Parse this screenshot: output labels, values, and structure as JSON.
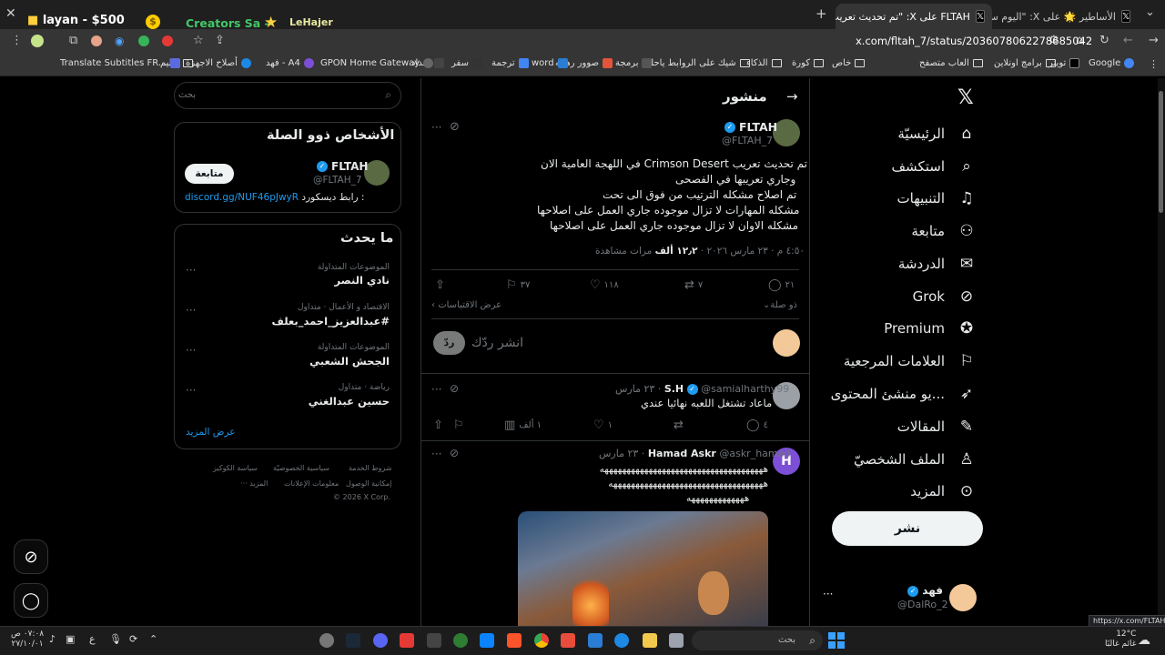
{
  "browser": {
    "tabs": [
      {
        "label": "الأساطير 🌟 على X: \"اليوم سيتم اط..."
      },
      {
        "label": "FLTAH على X: \"تم تحديث تعريب Cri..."
      }
    ],
    "url": "x.com/fltah_7/status/2036078062278685042",
    "status_url": "https://x.com/FLTAH_7"
  },
  "overlay": {
    "layan": "layan - $500",
    "creators": "Creators Sa - ",
    "lehajer": "LeHajer"
  },
  "bookmarks": [
    "Google",
    "تويتر",
    "برامج اونلاين",
    "العاب متصفح",
    "خاص",
    "كورة",
    "الذكاء",
    "شيك على الروابط ياحلو",
    "برمجة",
    "صوور رهيبه",
    "word",
    "ترجمة",
    "سفر",
    "سداد",
    "GPON Home Gateway",
    "فهد - A4",
    "أصلاح الاجهزة",
    "تعليم",
    "Translate Subtitles FR..."
  ],
  "nav": {
    "items": [
      {
        "label": "الرئيسيّة",
        "icon": "home-icon"
      },
      {
        "label": "استكشف",
        "icon": "search-icon"
      },
      {
        "label": "التنبيهات",
        "icon": "bell-icon"
      },
      {
        "label": "متابعة",
        "icon": "person-add-icon"
      },
      {
        "label": "الدردشة",
        "icon": "mail-icon"
      },
      {
        "label": "Grok",
        "icon": "grok-icon"
      },
      {
        "label": "Premium",
        "icon": "premium-icon"
      },
      {
        "label": "العلامات المرجعية",
        "icon": "bookmark-icon"
      },
      {
        "label": "...يو منشئ المحتوى",
        "icon": "rocket-icon"
      },
      {
        "label": "المقالات",
        "icon": "article-icon"
      },
      {
        "label": "الملف الشخصيّ",
        "icon": "profile-icon"
      },
      {
        "label": "المزيد",
        "icon": "more-icon"
      }
    ],
    "post_button": "نشر",
    "account": {
      "name": "فهد",
      "handle": "@DalRo_2"
    }
  },
  "post": {
    "header": "منشور",
    "author": {
      "name": "FLTAH",
      "handle": "@FLTAH_7"
    },
    "lines": [
      "تم تحديث تعريب Crimson Desert في اللهجة العامية الان",
      "وجاري تعريبها في الفصحى",
      "تم اصلاح مشكله الترتيب من فوق الى تحت",
      "مشكله المهارات لا تزال موجوده جاري العمل على اصلاحها",
      "مشكله الاوان لا تزال موجوده جاري العمل على اصلاحها"
    ],
    "meta_time": "٤:٥٠ م · ٢٣ مارس ٢٠٢٦ · ",
    "views_count": "١٢٫٢ ألف",
    "views_label": " مرات مشاهدة",
    "stats": {
      "replies": "٢١",
      "reposts": "٧",
      "likes": "١١٨",
      "bookmarks": "٣٧"
    },
    "sort_label": "ذو صلة",
    "quotes_label": "عرض الاقتباسات",
    "reply_placeholder": "انشر ردّك",
    "reply_button": "ردّ"
  },
  "replies": [
    {
      "name": "S.H",
      "handle": "@samialharthy99",
      "time": "٢٣ مارس",
      "text": "ماعاد تشتغل اللعبه نهائيا عندي",
      "stats": {
        "replies": "٤",
        "reposts": "",
        "likes": "١",
        "views": "١ ألف"
      }
    },
    {
      "name": "Hamad Askr",
      "handle": "@askr_hamad",
      "time": "٢٣ مارس",
      "avatar_letter": "H",
      "lines": [
        "هههههههههههههههههههههههههههههههههههههه",
        "هههههههههههههههههههههههههههههههههههه",
        "هههههههههههههه"
      ]
    }
  ],
  "sidebar": {
    "search_placeholder": "بحث",
    "related": {
      "title": "الأشخاص ذوو الصلة",
      "name": "FLTAH",
      "handle": "@FLTAH_7",
      "bio_label": "رابط ديسكورد : ",
      "bio_link": "discord.gg/NUF46pJwyR",
      "follow": "متابعة"
    },
    "trends": {
      "title": "ما يحدث",
      "items": [
        {
          "category": "الموضوعات المتداولة",
          "name": "نادي النصر"
        },
        {
          "category": "الاقتصاد و الأعمال · متداول",
          "name": "#عبدالعزيز_احمد_بعلف"
        },
        {
          "category": "الموضوعات المتداولة",
          "name": "الجحش الشعبي"
        },
        {
          "category": "رياضة · متداول",
          "name": "حسين عبدالغني"
        }
      ],
      "show_more": "عرض المزيد"
    },
    "footer": {
      "terms": "شروط الخدمة",
      "privacy": "سياسية الخصوصيّة",
      "cookies": "سياسة الكوكيز",
      "access": "إمكانية الوصول",
      "ads": "معلومات الإعلانات",
      "more": "··· المزيد",
      "copy": "© 2026 X Corp."
    }
  },
  "taskbar": {
    "search": "بحث",
    "time": "٠٧:٠٨ ص",
    "date": "٢٧/١٠/٠١",
    "lang": "ع",
    "weather_temp": "12°C",
    "weather_text": "غائم غالبًا"
  }
}
